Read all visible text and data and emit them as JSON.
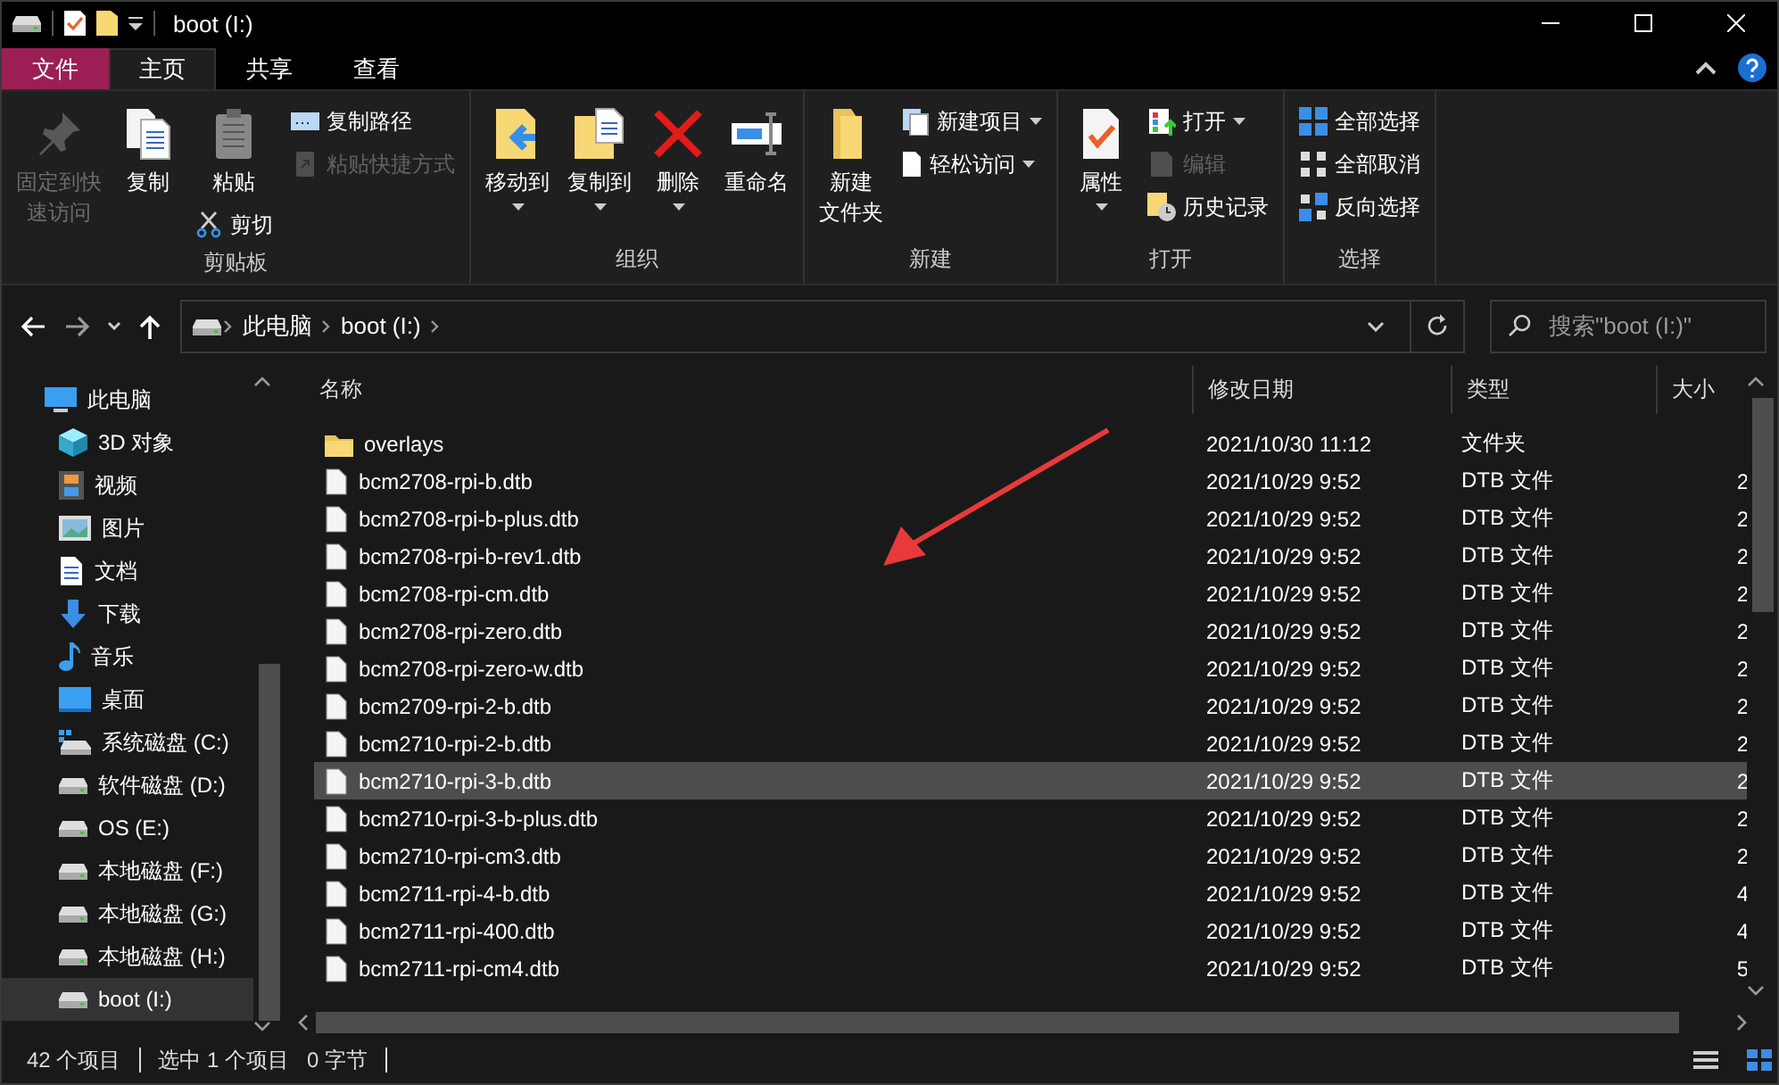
{
  "window": {
    "title": "boot (I:)"
  },
  "ribbon_tabs": [
    {
      "label": "文件",
      "kind": "file",
      "selected": false
    },
    {
      "label": "主页",
      "kind": "tab",
      "selected": true
    },
    {
      "label": "共享",
      "kind": "tab",
      "selected": false
    },
    {
      "label": "查看",
      "kind": "tab",
      "selected": false
    }
  ],
  "ribbon_groups": [
    {
      "label": "剪贴板",
      "columns": [
        [
          {
            "kind": "large",
            "lines": [
              "固定到快",
              "速访问"
            ],
            "disabled": true,
            "dropdown": false
          }
        ],
        [
          {
            "kind": "large",
            "lines": [
              "复制"
            ],
            "disabled": false,
            "dropdown": false
          }
        ],
        [
          {
            "kind": "large",
            "lines": [
              "粘贴"
            ],
            "disabled": false,
            "dropdown": false
          },
          {
            "kind": "small",
            "lines": [
              "剪切"
            ],
            "disabled": false,
            "dropdown": false
          }
        ],
        [
          {
            "kind": "small",
            "lines": [
              "复制路径"
            ],
            "disabled": false,
            "dropdown": false
          },
          {
            "kind": "small",
            "lines": [
              "粘贴快捷方式"
            ],
            "disabled": true,
            "dropdown": false
          }
        ]
      ]
    },
    {
      "label": "组织",
      "columns": [
        [
          {
            "kind": "large",
            "lines": [
              "移动到"
            ],
            "disabled": false,
            "dropdown": true
          }
        ],
        [
          {
            "kind": "large",
            "lines": [
              "复制到"
            ],
            "disabled": false,
            "dropdown": true
          }
        ],
        [
          {
            "kind": "large",
            "lines": [
              "删除"
            ],
            "disabled": false,
            "dropdown": true
          }
        ],
        [
          {
            "kind": "large",
            "lines": [
              "重命名"
            ],
            "disabled": false,
            "dropdown": false
          }
        ]
      ]
    },
    {
      "label": "新建",
      "columns": [
        [
          {
            "kind": "large",
            "lines": [
              "新建",
              "文件夹"
            ],
            "disabled": false,
            "dropdown": false
          }
        ],
        [
          {
            "kind": "small",
            "lines": [
              "新建项目"
            ],
            "disabled": false,
            "dropdown": true
          },
          {
            "kind": "small",
            "lines": [
              "轻松访问"
            ],
            "disabled": false,
            "dropdown": true
          }
        ]
      ]
    },
    {
      "label": "打开",
      "columns": [
        [
          {
            "kind": "large",
            "lines": [
              "属性"
            ],
            "disabled": false,
            "dropdown": true
          }
        ],
        [
          {
            "kind": "small",
            "lines": [
              "打开"
            ],
            "disabled": false,
            "dropdown": true
          },
          {
            "kind": "small",
            "lines": [
              "编辑"
            ],
            "disabled": true,
            "dropdown": false
          },
          {
            "kind": "small",
            "lines": [
              "历史记录"
            ],
            "disabled": false,
            "dropdown": false
          }
        ]
      ]
    },
    {
      "label": "选择",
      "columns": [
        [
          {
            "kind": "small",
            "lines": [
              "全部选择"
            ],
            "disabled": false,
            "dropdown": false
          },
          {
            "kind": "small",
            "lines": [
              "全部取消"
            ],
            "disabled": false,
            "dropdown": false
          },
          {
            "kind": "small",
            "lines": [
              "反向选择"
            ],
            "disabled": false,
            "dropdown": false
          }
        ]
      ]
    }
  ],
  "address": {
    "segments": [
      "此电脑",
      "boot (I:)"
    ]
  },
  "search": {
    "placeholder": "搜索\"boot (I:)\""
  },
  "sidebar": {
    "items": [
      {
        "label": "此电脑",
        "kind": "pc",
        "selected": false,
        "children": [
          {
            "label": "3D 对象",
            "kind": "cube",
            "selected": false
          },
          {
            "label": "视频",
            "kind": "film",
            "selected": false
          },
          {
            "label": "图片",
            "kind": "picture",
            "selected": false
          },
          {
            "label": "文档",
            "kind": "document",
            "selected": false
          },
          {
            "label": "下载",
            "kind": "download",
            "selected": false
          },
          {
            "label": "音乐",
            "kind": "music",
            "selected": false
          },
          {
            "label": "桌面",
            "kind": "desktop",
            "selected": false
          },
          {
            "label": "系统磁盘 (C:)",
            "kind": "sysdrive",
            "selected": false
          },
          {
            "label": "软件磁盘 (D:)",
            "kind": "drive",
            "selected": false
          },
          {
            "label": "OS (E:)",
            "kind": "drive",
            "selected": false
          },
          {
            "label": "本地磁盘 (F:)",
            "kind": "drive",
            "selected": false
          },
          {
            "label": "本地磁盘 (G:)",
            "kind": "drive",
            "selected": false
          },
          {
            "label": "本地磁盘 (H:)",
            "kind": "drive",
            "selected": false
          },
          {
            "label": "boot (I:)",
            "kind": "drive",
            "selected": true
          }
        ]
      }
    ]
  },
  "table": {
    "columns": [
      "名称",
      "修改日期",
      "类型",
      "大小"
    ],
    "rows": [
      {
        "name": "overlays",
        "kind": "folder",
        "date": "2021/10/30 11:12",
        "type": "文件夹",
        "size": "",
        "selected": false
      },
      {
        "name": "bcm2708-rpi-b.dtb",
        "kind": "file",
        "date": "2021/10/29 9:52",
        "type": "DTB 文件",
        "size": "2",
        "selected": false
      },
      {
        "name": "bcm2708-rpi-b-plus.dtb",
        "kind": "file",
        "date": "2021/10/29 9:52",
        "type": "DTB 文件",
        "size": "2",
        "selected": false
      },
      {
        "name": "bcm2708-rpi-b-rev1.dtb",
        "kind": "file",
        "date": "2021/10/29 9:52",
        "type": "DTB 文件",
        "size": "2",
        "selected": false
      },
      {
        "name": "bcm2708-rpi-cm.dtb",
        "kind": "file",
        "date": "2021/10/29 9:52",
        "type": "DTB 文件",
        "size": "2",
        "selected": false
      },
      {
        "name": "bcm2708-rpi-zero.dtb",
        "kind": "file",
        "date": "2021/10/29 9:52",
        "type": "DTB 文件",
        "size": "2",
        "selected": false
      },
      {
        "name": "bcm2708-rpi-zero-w.dtb",
        "kind": "file",
        "date": "2021/10/29 9:52",
        "type": "DTB 文件",
        "size": "2",
        "selected": false
      },
      {
        "name": "bcm2709-rpi-2-b.dtb",
        "kind": "file",
        "date": "2021/10/29 9:52",
        "type": "DTB 文件",
        "size": "2",
        "selected": false
      },
      {
        "name": "bcm2710-rpi-2-b.dtb",
        "kind": "file",
        "date": "2021/10/29 9:52",
        "type": "DTB 文件",
        "size": "2",
        "selected": false
      },
      {
        "name": "bcm2710-rpi-3-b.dtb",
        "kind": "file",
        "date": "2021/10/29 9:52",
        "type": "DTB 文件",
        "size": "2",
        "selected": true
      },
      {
        "name": "bcm2710-rpi-3-b-plus.dtb",
        "kind": "file",
        "date": "2021/10/29 9:52",
        "type": "DTB 文件",
        "size": "2",
        "selected": false
      },
      {
        "name": "bcm2710-rpi-cm3.dtb",
        "kind": "file",
        "date": "2021/10/29 9:52",
        "type": "DTB 文件",
        "size": "2",
        "selected": false
      },
      {
        "name": "bcm2711-rpi-4-b.dtb",
        "kind": "file",
        "date": "2021/10/29 9:52",
        "type": "DTB 文件",
        "size": "4",
        "selected": false
      },
      {
        "name": "bcm2711-rpi-400.dtb",
        "kind": "file",
        "date": "2021/10/29 9:52",
        "type": "DTB 文件",
        "size": "4",
        "selected": false
      },
      {
        "name": "bcm2711-rpi-cm4.dtb",
        "kind": "file",
        "date": "2021/10/29 9:52",
        "type": "DTB 文件",
        "size": "5",
        "selected": false
      }
    ]
  },
  "status_bar": {
    "items": [
      "42 个项目",
      "选中 1 个项目",
      "0 字节"
    ]
  }
}
